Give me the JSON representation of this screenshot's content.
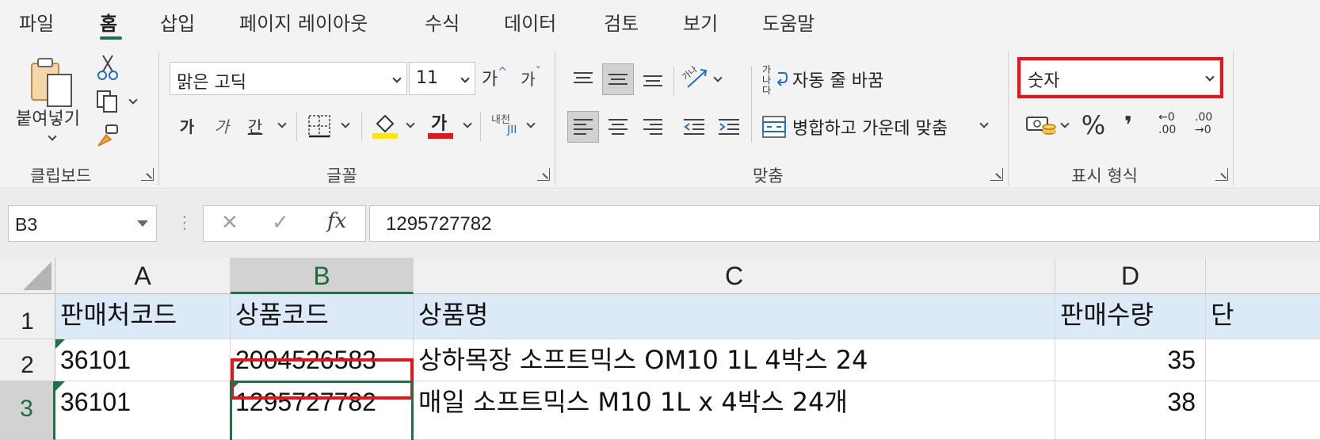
{
  "menu": {
    "tabs": [
      "파일",
      "홈",
      "삽입",
      "페이지 레이아웃",
      "수식",
      "데이터",
      "검토",
      "보기",
      "도움말"
    ],
    "active_tab": "홈"
  },
  "ribbon": {
    "clipboard": {
      "paste_label": "붙여넣기",
      "group_label": "클립보드"
    },
    "font": {
      "font_name": "맑은 고딕",
      "font_size": "11",
      "grow_label": "가",
      "shrink_label": "가",
      "bold_label": "가",
      "italic_label": "가",
      "underline_label": "간",
      "font_color_label": "가",
      "phonetic_label": "내천",
      "group_label": "글꼴",
      "fill_color": "#ffe800",
      "font_color": "#e8141b"
    },
    "alignment": {
      "orientation_label": "가나",
      "wrap_text_icon_label": "가나다",
      "wrap_text_label": "자동 줄 바꿈",
      "merge_center_label": "병합하고 가운데 맞춤",
      "group_label": "맞춤"
    },
    "number": {
      "format_value": "숫자",
      "percent_label": "%",
      "comma_label": "❜",
      "increase_decimal_label": "←0 .00",
      "decrease_decimal_label": ".00 →0",
      "group_label": "표시 형식"
    }
  },
  "formula_bar": {
    "name_box": "B3",
    "cancel_glyph": "✕",
    "enter_glyph": "✓",
    "fx_label": "fx",
    "formula_value": "1295727782"
  },
  "sheet": {
    "columns": [
      "A",
      "B",
      "C",
      "D"
    ],
    "selected_column": "B",
    "rows": [
      {
        "num": "1",
        "cells": [
          "판매처코드",
          "상품코드",
          "상품명",
          "판매수량",
          "단"
        ]
      },
      {
        "num": "2",
        "cells": [
          "36101",
          "2004526583",
          "상하목장 소프트믹스 OM10 1L 4박스 24",
          "35",
          ""
        ]
      },
      {
        "num": "3",
        "cells": [
          "36101",
          "1295727782",
          "매일 소프트믹스 M10 1L x 4박스 24개",
          "38",
          ""
        ]
      }
    ],
    "selected_row": "3",
    "active_cell": "B3",
    "highlighted_cell": "B2"
  },
  "colors": {
    "excel_green": "#1e7145",
    "highlight_red": "#e8141b",
    "header_fill": "#dce9f6"
  }
}
